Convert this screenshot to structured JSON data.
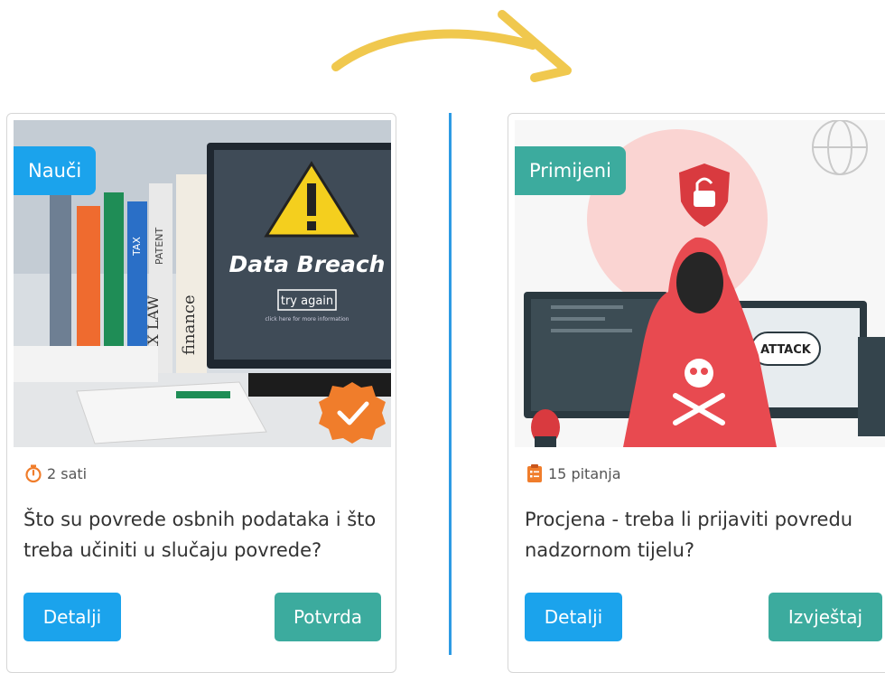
{
  "cards": [
    {
      "tag": "Nauči",
      "meta": "2 sati",
      "meta_icon": "stopwatch-icon",
      "title": "Što su povrede osbnih podataka i što treba učiniti u slučaju povrede?",
      "image_texts": {
        "headline": "Data Breach",
        "button": "try again",
        "small": "click here for more information",
        "binders": [
          "TAX LAW",
          "finance",
          "TAX",
          "PATENT"
        ]
      },
      "buttons": {
        "details": "Detalji",
        "action": "Potvrda"
      }
    },
    {
      "tag": "Primijeni",
      "meta": "15 pitanja",
      "meta_icon": "clipboard-list-icon",
      "title": "Procjena - treba li prijaviti povredu nadzornom tijelu?",
      "image_texts": {
        "screen": "ATTACK"
      },
      "buttons": {
        "details": "Detalji",
        "action": "Izvještaj"
      }
    }
  ],
  "colors": {
    "blue": "#1ba3ec",
    "teal": "#3cab9e",
    "arrow": "#f0c84e",
    "divider": "#2d9be4",
    "orange": "#f07d2b"
  }
}
